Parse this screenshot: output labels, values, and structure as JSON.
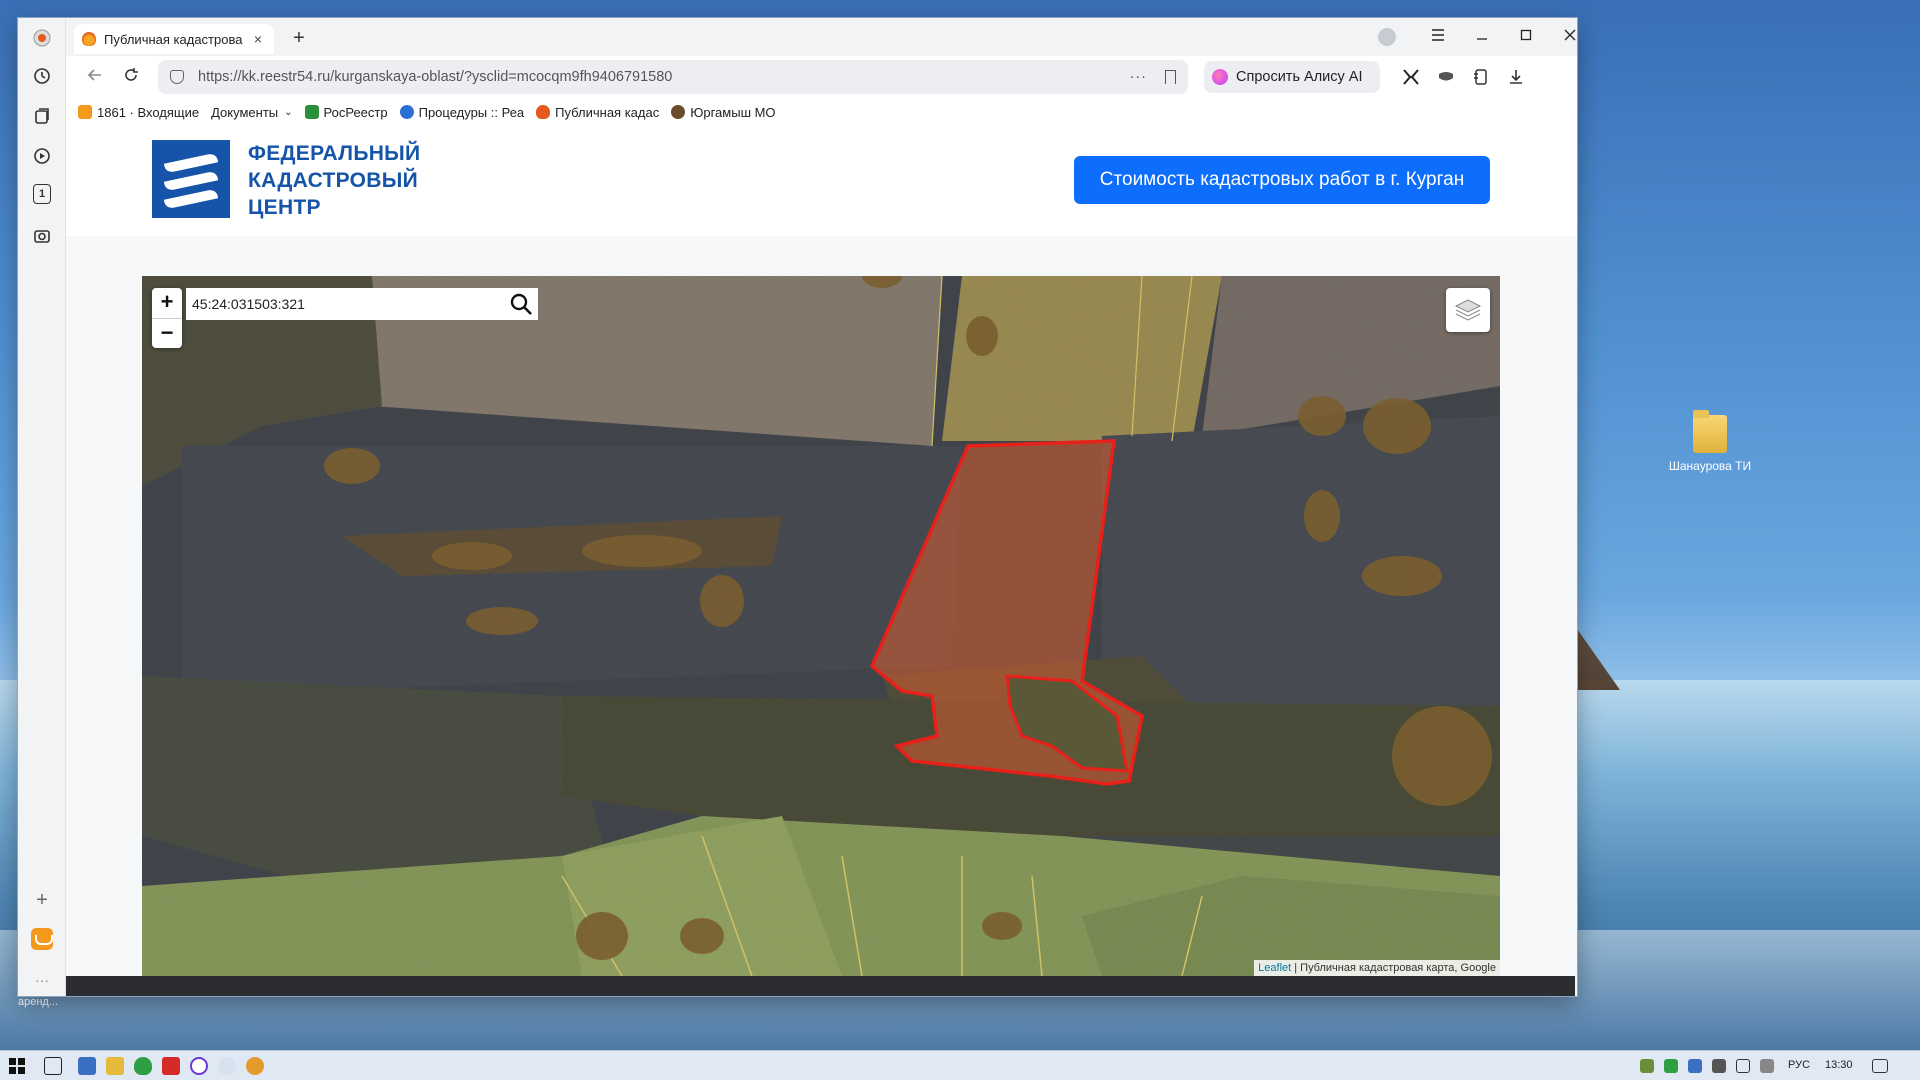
{
  "desktop": {
    "icon_label": "Шанаурова ТИ",
    "edge_label": "аренд..."
  },
  "browser": {
    "tab_title": "Публичная кадастрова",
    "tab_close": "×",
    "new_tab": "+",
    "url_domain": "kk.reestr54.ru",
    "url_full": "https://kk.reestr54.ru/kurganskaya-oblast/?ysclid=mcocqm9fh9406791580",
    "url_dots": "···",
    "alice_label": "Спросить Алису AI",
    "bookmarks": [
      {
        "label": "1861 · Входящие",
        "color": "#f39a1d"
      },
      {
        "label": "Документы",
        "color": "#ffffff"
      },
      {
        "label": "РосРеестр",
        "color": "#2a8f3a"
      },
      {
        "label": "Процедуры :: Реа",
        "color": "#2b6fd6"
      },
      {
        "label": "Публичная кадас",
        "color": "#e65a1e"
      },
      {
        "label": "Юргамыш МО",
        "color": "#6b4b2b"
      }
    ]
  },
  "site": {
    "logo_line1": "ФЕДЕРАЛЬНЫЙ",
    "logo_line2": "КАДАСТРОВЫЙ",
    "logo_line3": "ЦЕНТР",
    "cta_label": "Стоимость кадастровых работ в г. Курган"
  },
  "map": {
    "search_value": "45:24:031503:321",
    "zoom_in": "+",
    "zoom_out": "−",
    "attribution_link": "Leaflet",
    "attribution_text": " | Публичная кадастровая карта, Google",
    "parcel_color": "#e8201a"
  },
  "taskbar": {
    "lang": "РУС",
    "time": "13:30"
  }
}
